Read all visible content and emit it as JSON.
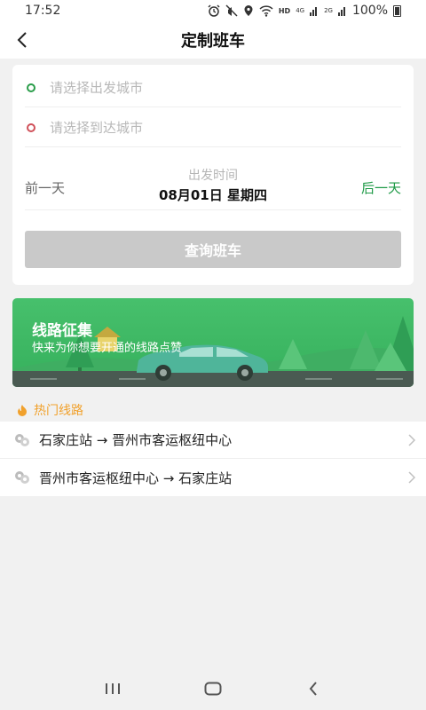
{
  "status_bar": {
    "time": "17:52",
    "network_label": "HD",
    "signal1_label": "4G",
    "signal2_label": "2G",
    "battery_pct": "100%"
  },
  "header": {
    "title": "定制班车",
    "back_icon": "chevron-left-icon"
  },
  "search": {
    "departure_placeholder": "请选择出发城市",
    "arrival_placeholder": "请选择到达城市",
    "prev_day": "前一天",
    "next_day": "后一天",
    "date_label": "出发时间",
    "date_value": "08月01日 星期四",
    "query_button": "查询班车"
  },
  "banner": {
    "title": "线路征集",
    "subtitle": "快来为你想要开通的线路点赞"
  },
  "hot_routes": {
    "title": "热门线路",
    "items": [
      {
        "label": "石家庄站 → 晋州市客运枢纽中心"
      },
      {
        "label": "晋州市客运枢纽中心 → 石家庄站"
      }
    ]
  },
  "colors": {
    "accent_green": "#1e9a46",
    "departure_dot": "#2a9d4a",
    "arrival_dot": "#d0515a",
    "hot_orange": "#f1a12c",
    "button_disabled": "#c9c9c9"
  }
}
